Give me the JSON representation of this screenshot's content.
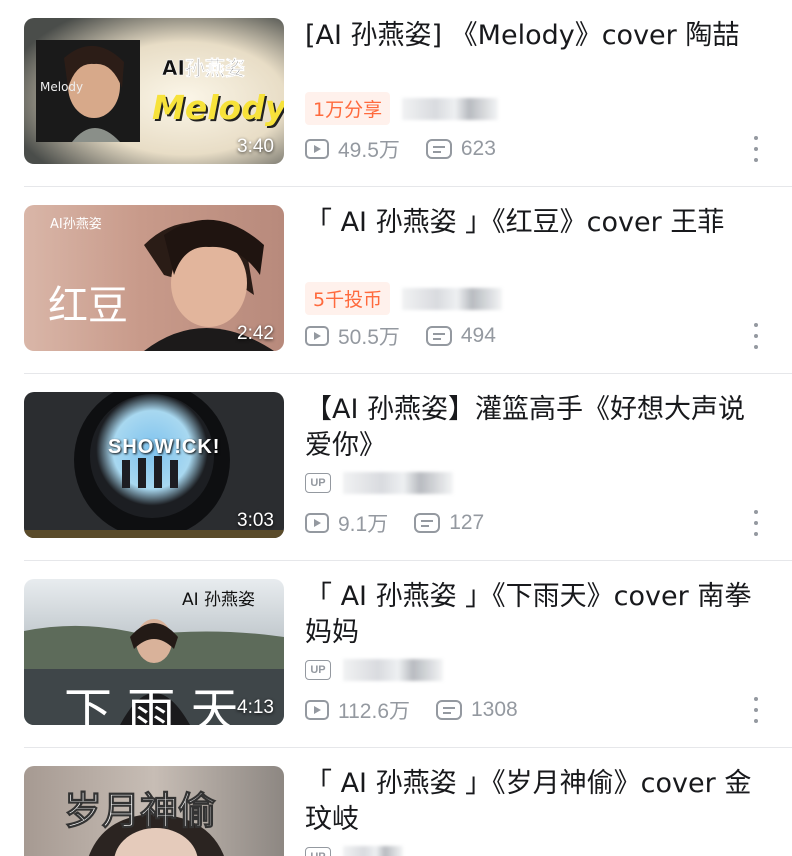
{
  "videos": [
    {
      "title": "[AI  孙燕姿]  《Melody》cover  陶喆",
      "duration": "3:40",
      "badge": "1万分享",
      "views": "49.5万",
      "comments": "623",
      "thumb_text": [
        "AI孙燕姿",
        "Melody",
        "Melody"
      ]
    },
    {
      "title": "「 AI  孙燕姿 」《红豆》cover  王菲",
      "duration": "2:42",
      "badge": "5千投币",
      "views": "50.5万",
      "comments": "494",
      "thumb_text": [
        "AI孙燕姿",
        "红豆"
      ]
    },
    {
      "title": "【AI  孙燕姿】灌篮高手《好想大声说爱你》",
      "duration": "3:03",
      "up_label": "UP",
      "views": "9.1万",
      "comments": "127",
      "thumb_text": [
        "SHOW!CK!"
      ]
    },
    {
      "title": "「 AI  孙燕姿 」《下雨天》cover  南拳妈妈",
      "duration": "4:13",
      "up_label": "UP",
      "views": "112.6万",
      "comments": "1308",
      "thumb_text": [
        "AI 孙燕姿",
        "下 雨 天"
      ]
    },
    {
      "title": "「 AI  孙燕姿 」《岁月神偷》cover  金玟岐",
      "up_label": "UP",
      "thumb_text": [
        "岁月神偷"
      ]
    }
  ],
  "icons": {
    "views": "play-count-icon",
    "comments": "comment-count-icon",
    "more": "more-options-icon"
  },
  "colors": {
    "badge_text": "#ff6a3d",
    "badge_bg": "#fff1ec",
    "meta_gray": "#9499a0"
  }
}
